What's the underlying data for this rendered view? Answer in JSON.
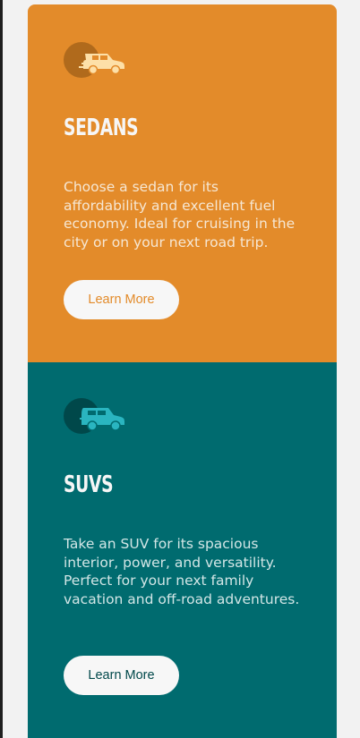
{
  "colors": {
    "sedans_bg": "#e38b2a",
    "suvs_bg": "#006b6f",
    "sedans_text": "#f6e7d3",
    "suvs_text": "#d2e6e6",
    "sedans_button_text": "#e38b2a",
    "suvs_button_text": "#00484a",
    "button_bg": "#f7f7f7"
  },
  "cards": [
    {
      "title": "SEDANS",
      "icon": "sedan-car-icon",
      "description": "Choose a sedan for its affordability and excellent fuel economy. Ideal for cruising in the city or on your next road trip.",
      "button_label": "Learn More"
    },
    {
      "title": "SUVS",
      "icon": "suv-car-icon",
      "description": "Take an SUV for its spacious interior, power, and versatility. Perfect for your next family vacation and off-road adventures.",
      "button_label": "Learn More"
    }
  ]
}
